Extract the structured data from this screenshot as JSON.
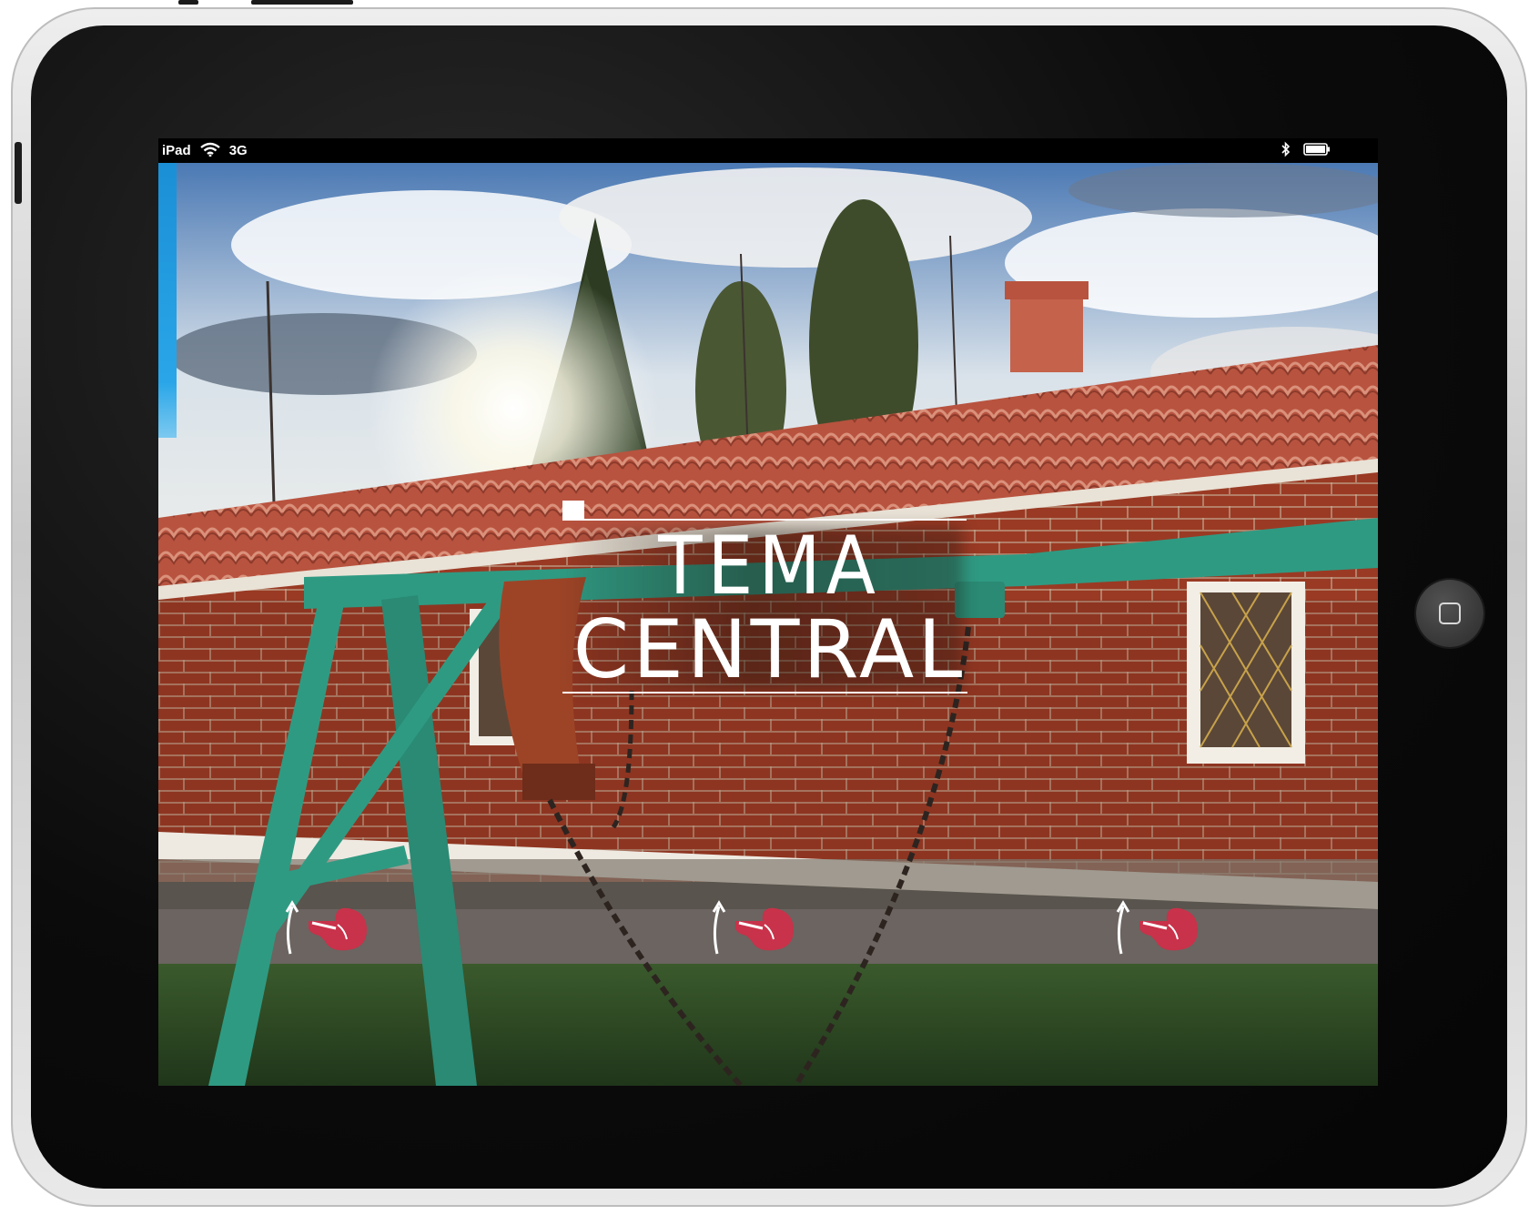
{
  "device": {
    "name": "iPad"
  },
  "status_bar": {
    "device_label": "iPad",
    "network_label": "3G",
    "wifi_icon": "wifi-icon",
    "bluetooth_icon": "bluetooth-icon",
    "battery_icon": "battery-icon"
  },
  "title": {
    "line1": "TEMA",
    "line2": "CENTRAL"
  },
  "gestures": [
    {
      "icon": "swipe-up-hand-icon"
    },
    {
      "icon": "swipe-up-hand-icon"
    },
    {
      "icon": "swipe-up-hand-icon"
    }
  ],
  "colors": {
    "accent_tab": "#1b8fd6",
    "gesture_hand": "#c8324a",
    "swing_frame": "#2f9a82",
    "brick": "#9a3a24",
    "roof": "#b8533f"
  }
}
